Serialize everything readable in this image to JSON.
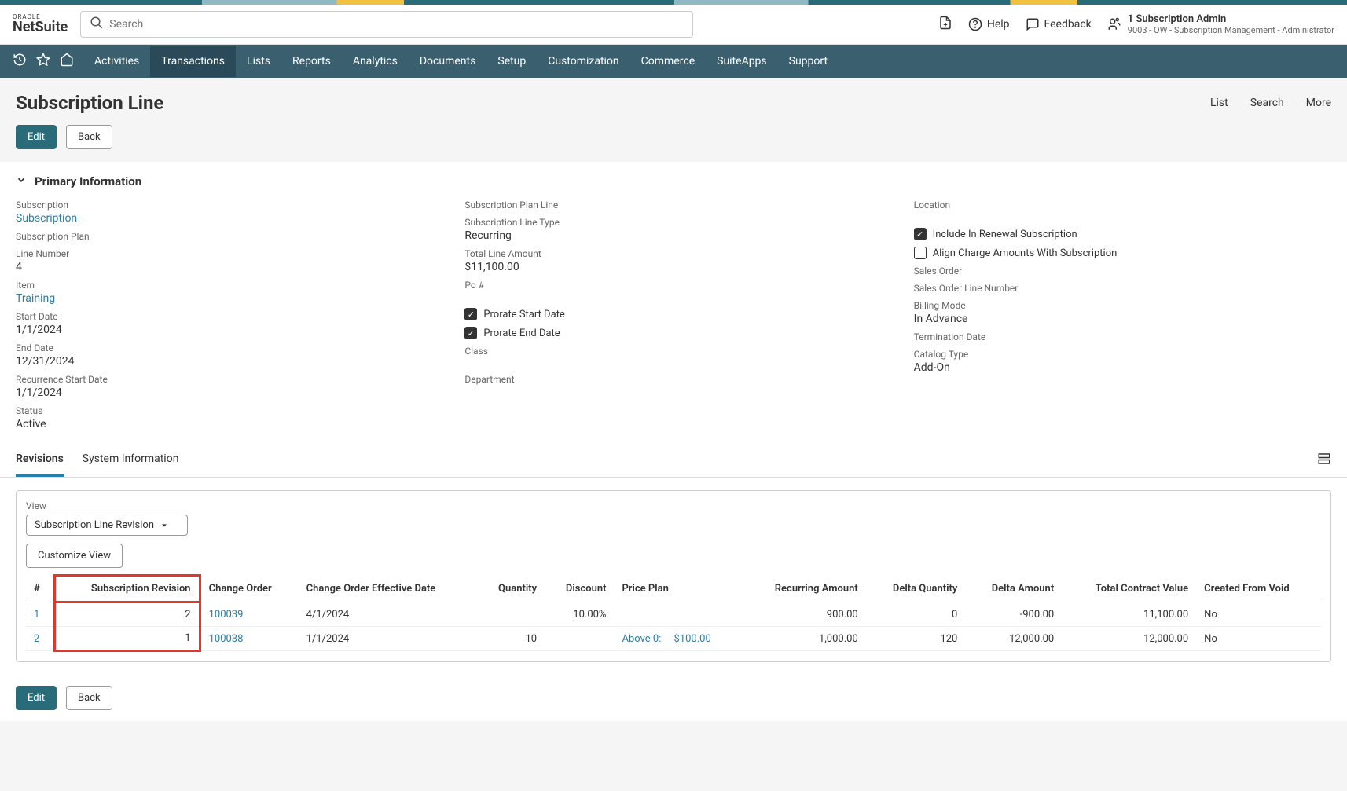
{
  "header": {
    "logo_top": "ORACLE",
    "logo_bottom": "NetSuite",
    "search_placeholder": "Search",
    "help_label": "Help",
    "feedback_label": "Feedback",
    "user_name": "1 Subscription Admin",
    "user_sub": "9003 - OW - Subscription Management  -  Administrator"
  },
  "nav": {
    "items": [
      "Activities",
      "Transactions",
      "Lists",
      "Reports",
      "Analytics",
      "Documents",
      "Setup",
      "Customization",
      "Commerce",
      "SuiteApps",
      "Support"
    ],
    "active": "Transactions"
  },
  "page": {
    "title": "Subscription Line",
    "actions": [
      "List",
      "Search",
      "More"
    ],
    "edit_label": "Edit",
    "back_label": "Back"
  },
  "primary": {
    "section_title": "Primary Information",
    "col1": {
      "subscription_label": "Subscription",
      "subscription_value": "Subscription",
      "subscription_plan_label": "Subscription Plan",
      "line_number_label": "Line Number",
      "line_number_value": "4",
      "item_label": "Item",
      "item_value": "Training",
      "start_date_label": "Start Date",
      "start_date_value": "1/1/2024",
      "end_date_label": "End Date",
      "end_date_value": "12/31/2024",
      "recurrence_start_label": "Recurrence Start Date",
      "recurrence_start_value": "1/1/2024",
      "status_label": "Status",
      "status_value": "Active"
    },
    "col2": {
      "plan_line_label": "Subscription Plan Line",
      "line_type_label": "Subscription Line Type",
      "line_type_value": "Recurring",
      "total_amount_label": "Total Line Amount",
      "total_amount_value": "$11,100.00",
      "po_label": "Po #",
      "prorate_start_label": "Prorate Start Date",
      "prorate_end_label": "Prorate End Date",
      "class_label": "Class",
      "department_label": "Department"
    },
    "col3": {
      "location_label": "Location",
      "include_renewal_label": "Include In Renewal Subscription",
      "align_charges_label": "Align Charge Amounts With Subscription",
      "sales_order_label": "Sales Order",
      "sales_order_line_label": "Sales Order Line Number",
      "billing_mode_label": "Billing Mode",
      "billing_mode_value": "In Advance",
      "termination_label": "Termination Date",
      "catalog_type_label": "Catalog Type",
      "catalog_type_value": "Add-On"
    }
  },
  "tabs": {
    "revisions": "Revisions",
    "system_info": "System Information"
  },
  "sublist": {
    "view_label": "View",
    "view_value": "Subscription Line Revision",
    "customize_label": "Customize View",
    "headers": [
      "#",
      "Subscription Revision",
      "Change Order",
      "Change Order Effective Date",
      "Quantity",
      "Discount",
      "Price Plan",
      "Recurring Amount",
      "Delta Quantity",
      "Delta Amount",
      "Total Contract Value",
      "Created From Void"
    ],
    "rows": [
      {
        "num": "1",
        "rev": "2",
        "change_order": "100039",
        "eff_date": "4/1/2024",
        "qty": "",
        "discount": "10.00%",
        "price_plan_label": "",
        "price_plan_value": "",
        "recurring": "900.00",
        "delta_qty": "0",
        "delta_amt": "-900.00",
        "tcv": "11,100.00",
        "void": "No"
      },
      {
        "num": "2",
        "rev": "1",
        "change_order": "100038",
        "eff_date": "1/1/2024",
        "qty": "10",
        "discount": "",
        "price_plan_label": "Above 0:",
        "price_plan_value": "$100.00",
        "recurring": "1,000.00",
        "delta_qty": "120",
        "delta_amt": "12,000.00",
        "tcv": "12,000.00",
        "void": "No"
      }
    ]
  }
}
